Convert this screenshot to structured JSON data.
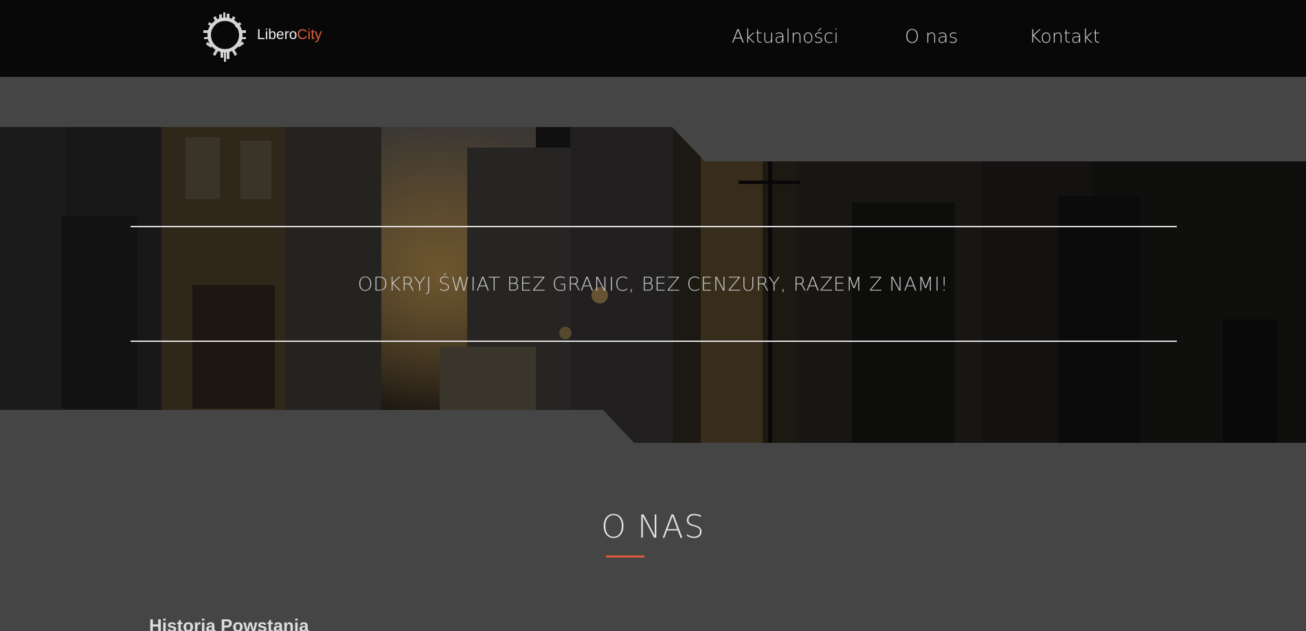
{
  "header": {
    "logo": {
      "prefix": "Libero",
      "accent": "City"
    },
    "nav": [
      {
        "label": "Aktualności"
      },
      {
        "label": "O nas"
      },
      {
        "label": "Kontakt"
      }
    ]
  },
  "hero": {
    "tagline": "ODKRYJ ŚWIAT BEZ GRANIC, BEZ CENZURY, RAZEM Z NAMI!"
  },
  "about": {
    "title": "O NAS",
    "subheading": "Historia Powstania"
  },
  "colors": {
    "accent": "#e05a3a",
    "header_bg": "#080808",
    "page_bg": "#454545"
  }
}
